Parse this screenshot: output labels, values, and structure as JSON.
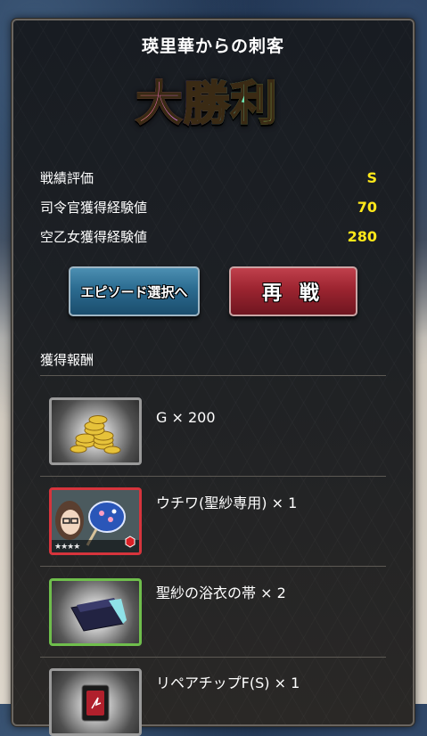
{
  "header": {
    "title": "瑛里華からの刺客",
    "victory_text": "大勝利"
  },
  "stats": [
    {
      "label": "戦績評価",
      "value": "S"
    },
    {
      "label": "司令官獲得経験値",
      "value": "70"
    },
    {
      "label": "空乙女獲得経験値",
      "value": "280"
    }
  ],
  "buttons": {
    "episode_select": "エピソード選択へ",
    "retry": "再 戦"
  },
  "rewards_section": {
    "title": "獲得報酬",
    "items": [
      {
        "label": "G × 200",
        "icon": "gold-coins-icon",
        "frame_color": "#9a9a9a"
      },
      {
        "label": "ウチワ(聖紗専用) × 1",
        "icon": "uchiwa-fan-portrait-icon",
        "frame_color": "#d6343c",
        "rarity": "★★★★"
      },
      {
        "label": "聖紗の浴衣の帯 × 2",
        "icon": "yukata-obi-icon",
        "frame_color": "#6fbe4c"
      },
      {
        "label": "リペアチップF(S) × 1",
        "icon": "repair-chip-icon",
        "frame_color": "#9a9a9a"
      }
    ]
  }
}
